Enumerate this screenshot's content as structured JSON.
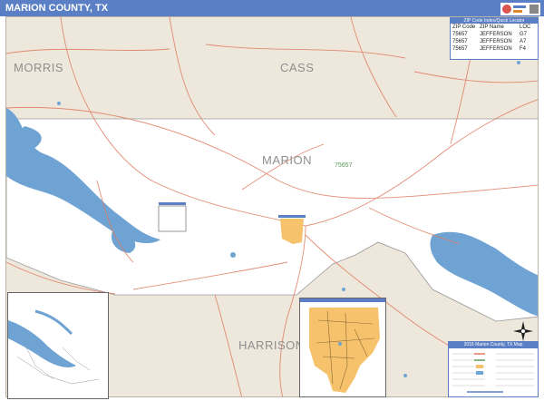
{
  "title": "MARION COUNTY, TX",
  "colors": {
    "title_bar": "#5b7fc4",
    "land_outside": "#ede7dc",
    "county_fill": "#ffffff",
    "water": "#6fa3d3",
    "roads": "#e07a5f",
    "city": "#f6c26b"
  },
  "county_labels": {
    "morris": "MORRIS",
    "cass": "CASS",
    "marion": "MARION",
    "harrison": "HARRISON"
  },
  "map_zip_label": "75657",
  "zip_table": {
    "header": "ZIP Code Index/Quick Locator",
    "columns": [
      "ZIP Code",
      "ZIP Name",
      "LOC"
    ],
    "rows": [
      [
        "75657",
        "JEFFERSON",
        "G7"
      ],
      [
        "75657",
        "JEFFERSON",
        "A7"
      ],
      [
        "75657",
        "JEFFERSON",
        "F4"
      ]
    ]
  },
  "legend": {
    "title": "2016 Marion County, TX Map"
  },
  "icons": [
    "compass-rose-icon",
    "publisher-logo-icon"
  ]
}
